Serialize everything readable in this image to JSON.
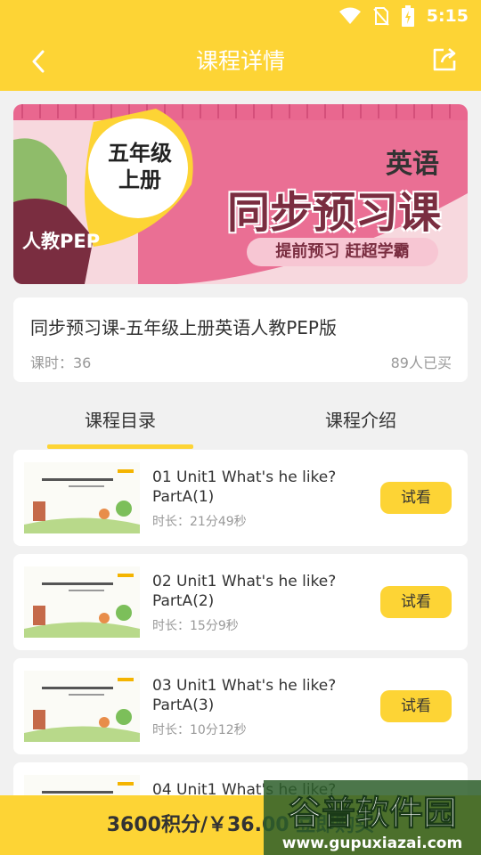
{
  "status": {
    "time": "5:15"
  },
  "appbar": {
    "title": "课程详情",
    "back_icon": "back-arrow-icon",
    "share_icon": "share-icon"
  },
  "banner": {
    "grade_line1": "五年级",
    "grade_line2": "上册",
    "edition": "人教PEP",
    "subject": "英语",
    "main_title": "同步预习课",
    "slogan": "提前预习 赶超学霸",
    "colors": {
      "pink": "#ea6f94",
      "dark": "#7a2d40",
      "yellow": "#fdd435",
      "green": "#8fbc6a"
    }
  },
  "course": {
    "title": "同步预习课-五年级上册英语人教PEP版",
    "lessons": "课时：36",
    "buyers": "89人已买"
  },
  "tabs": [
    {
      "label": "课程目录",
      "active": true
    },
    {
      "label": "课程介绍",
      "active": false
    }
  ],
  "lessons": [
    {
      "title": "01 Unit1 What's he like? PartA(1)",
      "duration": "时长：21分49秒",
      "action": "试看"
    },
    {
      "title": "02 Unit1 What's he like? PartA(2)",
      "duration": "时长：15分9秒",
      "action": "试看"
    },
    {
      "title": "03 Unit1 What's he like? PartA(3)",
      "duration": "时长：10分12秒",
      "action": "试看"
    },
    {
      "title": "04 Unit1 What's he like?",
      "duration": "",
      "action": ""
    }
  ],
  "bottom": {
    "price": "3600积分/￥36.00 立即购买"
  },
  "watermark": {
    "line1": "谷普软件园",
    "line2": "www.gupuxiazai.com"
  }
}
